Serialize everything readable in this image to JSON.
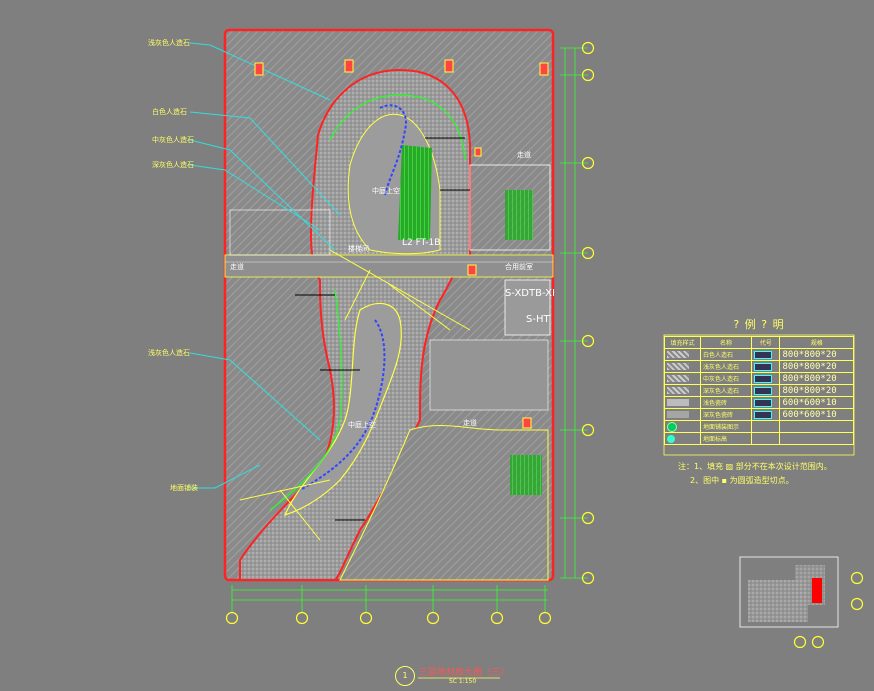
{
  "legend": {
    "title": "? 例 ? 明",
    "headers": [
      "填充样式",
      "名称",
      "代号",
      "规格"
    ],
    "rows": [
      {
        "name": "白色人造石",
        "spec": "800*800*20"
      },
      {
        "name": "浅灰色人造石",
        "spec": "800*800*20"
      },
      {
        "name": "中灰色人造石",
        "spec": "800*800*20"
      },
      {
        "name": "深灰色人造石",
        "spec": "800*800*20"
      },
      {
        "name": "浅色瓷砖",
        "spec": "600*600*10"
      },
      {
        "name": "深灰色瓷砖",
        "spec": "600*600*10"
      },
      {
        "name": "地面铺装图示",
        "spec": ""
      },
      {
        "name": "地面标高",
        "spec": ""
      }
    ]
  },
  "notes": {
    "line1": "注：1、填充 ▨ 部分不在本次设计范围内。",
    "line2": "2、图中 ▪ 为圆弧造型切点。"
  },
  "caption": {
    "number": "1",
    "title": "三层地材放大图（三）",
    "scale": "SC  1:150"
  },
  "plan_labels": {
    "center_top": "中庭上空",
    "center_bottom": "中庭上空",
    "sign_a": "S-XDTB-XI",
    "sign_b": "S-HT",
    "right_mid": "合用前室",
    "right_top": "走道",
    "stair": "楼梯间",
    "left_mid": "走道",
    "text_fl": "L2 FT-1B",
    "right_lower": "走道"
  },
  "callouts": [
    {
      "text": "浅灰色人造石"
    },
    {
      "text": "白色人造石"
    },
    {
      "text": "中灰色人造石"
    },
    {
      "text": "深灰色人造石"
    },
    {
      "text": "浅灰色人造石"
    },
    {
      "text": "地面铺装"
    }
  ]
}
